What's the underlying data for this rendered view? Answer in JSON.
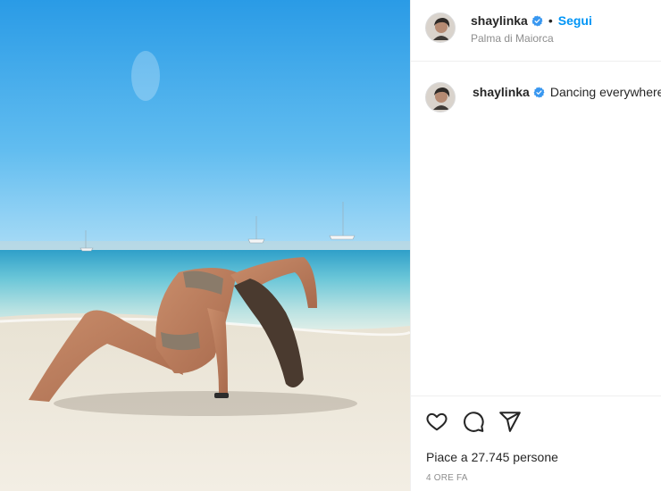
{
  "post": {
    "username": "shaylinka",
    "verified": true,
    "separator": "•",
    "follow_label": "Segui",
    "location": "Palma di Maiorca",
    "caption": "Dancing everywhere",
    "likes_text": "Piace a 27.745 persone",
    "timestamp": "4 ORE FA"
  },
  "icons": {
    "verified": "verified-badge-icon",
    "like": "heart-icon",
    "comment": "comment-bubble-icon",
    "share": "paper-plane-icon"
  },
  "colors": {
    "accent": "#0095f6",
    "verified_badge": "#3897f0",
    "secondary_text": "#8e8e8e",
    "divider": "#efefef"
  }
}
